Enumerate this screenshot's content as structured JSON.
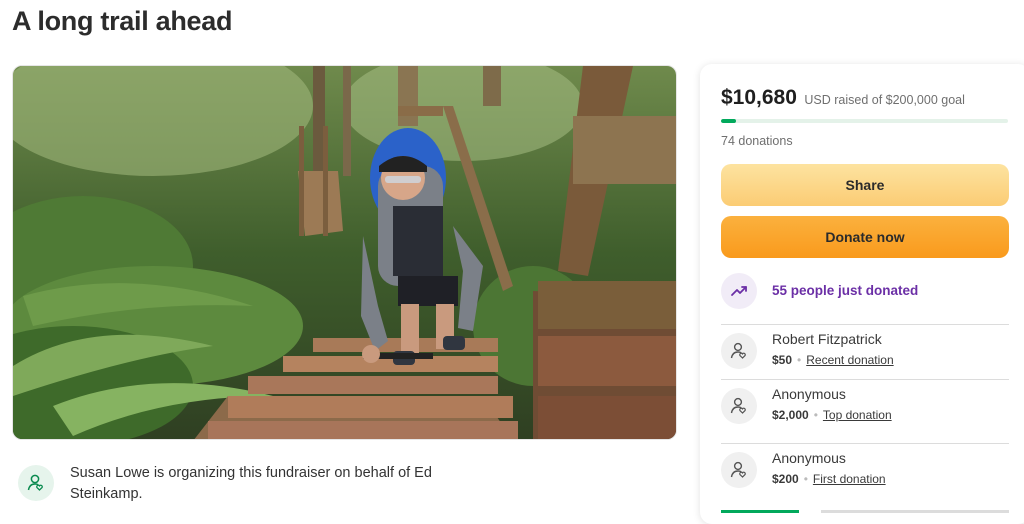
{
  "page": {
    "title": "A long trail ahead"
  },
  "hero": {
    "image_desc": "hiker climbing wooden forest stairs",
    "icon": "photo"
  },
  "organizer": {
    "icon": "user-heart-icon",
    "text": "Susan Lowe is organizing this fundraiser on behalf of Ed Steinkamp."
  },
  "donation_card": {
    "amount_raised": "$10,680",
    "goal_text": "USD raised of $200,000 goal",
    "progress_fraction": 0.0534,
    "donations_count": "74 donations",
    "share_label": "Share",
    "donate_label": "Donate now",
    "trend_text": "55 people just donated",
    "donors": [
      {
        "name": "Robert Fitzpatrick",
        "amount": "$50",
        "label": "Recent donation"
      },
      {
        "name": "Anonymous",
        "amount": "$2,000",
        "label": "Top donation"
      },
      {
        "name": "Anonymous",
        "amount": "$200",
        "label": "First donation"
      }
    ]
  },
  "colors": {
    "brand_green": "#02a95c",
    "share_button": "#fcd78a",
    "donate_button": "#f9a62b",
    "trend_purple": "#6b2fa6"
  }
}
